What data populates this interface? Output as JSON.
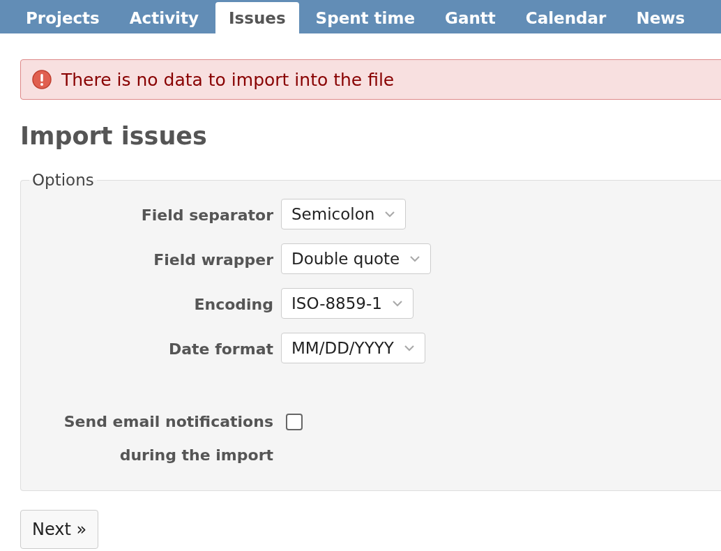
{
  "tabs": [
    {
      "label": "Projects",
      "selected": false
    },
    {
      "label": "Activity",
      "selected": false
    },
    {
      "label": "Issues",
      "selected": true
    },
    {
      "label": "Spent time",
      "selected": false
    },
    {
      "label": "Gantt",
      "selected": false
    },
    {
      "label": "Calendar",
      "selected": false
    },
    {
      "label": "News",
      "selected": false
    }
  ],
  "flash": {
    "kind": "error",
    "message": "There is no data to import into the file"
  },
  "title": "Import issues",
  "options": {
    "legend": "Options",
    "fields": [
      {
        "label": "Field separator",
        "value": "Semicolon"
      },
      {
        "label": "Field wrapper",
        "value": "Double quote"
      },
      {
        "label": "Encoding",
        "value": "ISO-8859-1"
      },
      {
        "label": "Date format",
        "value": "MM/DD/YYYY"
      }
    ],
    "notifications": {
      "label": "Send email notifications during the import",
      "checked": false
    }
  },
  "buttons": [
    "Next »"
  ]
}
